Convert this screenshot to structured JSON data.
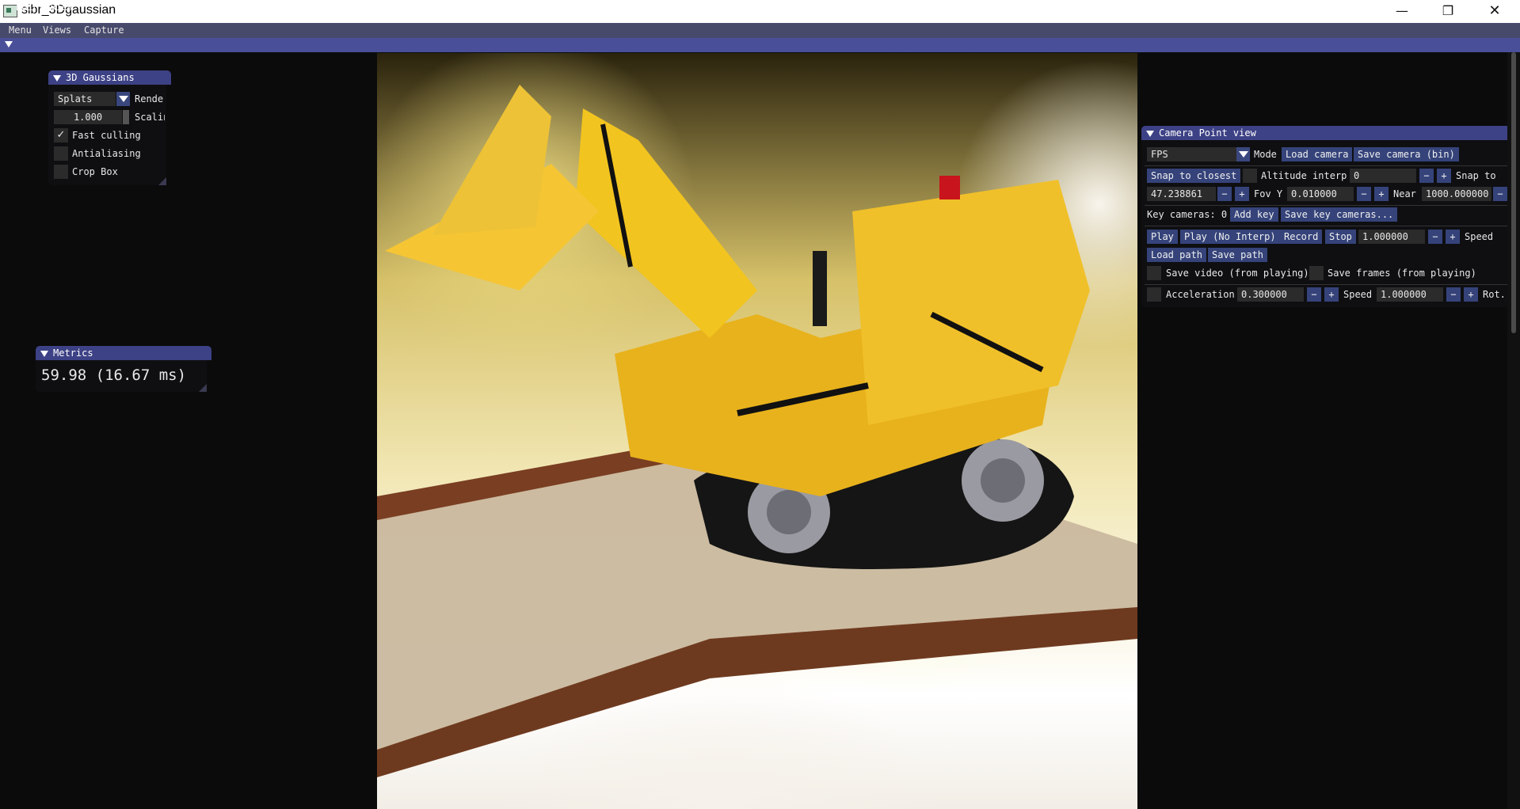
{
  "window": {
    "title": "sibr_3Dgaussian",
    "minimize": "—",
    "maximize": "❐",
    "close": "✕"
  },
  "menubar": {
    "items": [
      "Menu",
      "Views",
      "Capture"
    ]
  },
  "point_view": {
    "title": "Point view"
  },
  "gaussians": {
    "title": "3D Gaussians",
    "mode_value": "Splats",
    "render_label": "Render",
    "scaling_value": "1.000",
    "scaling_label": "Scaling",
    "fast_culling_label": "Fast culling",
    "fast_culling_checked": "✓",
    "antialiasing_label": "Antialiasing",
    "crop_box_label": "Crop Box"
  },
  "metrics": {
    "title": "Metrics",
    "value": "59.98 (16.67 ms)"
  },
  "camera": {
    "title": "Camera Point view",
    "mode_value": "FPS",
    "mode_label": "Mode",
    "load_camera": "Load camera",
    "save_camera": "Save camera (bin)",
    "snap_closest": "Snap to closest",
    "altitude_label": "Altitude interp",
    "altitude_value": "0",
    "snap_to_label": "Snap to",
    "val_1": "47.238861",
    "fov_label": "Fov Y",
    "fov_value": "0.010000",
    "near_label": "Near",
    "near_value": "1000.000000",
    "key_cameras_label": "Key cameras: 0",
    "add_key": "Add key",
    "save_key_cameras": "Save key cameras...",
    "play": "Play",
    "play_no_interp": "Play (No Interp)",
    "record": "Record",
    "stop": "Stop",
    "speed_value": "1.000000",
    "speed_label": "Speed",
    "load_path": "Load path",
    "save_path": "Save path",
    "save_video_label": "Save video (from playing)",
    "save_frames_label": "Save frames (from playing)",
    "acceleration_label": "Acceleration",
    "acceleration_value": "0.300000",
    "speed2_label": "Speed",
    "speed2_value": "1.000000",
    "rot_label": "Rot. sp",
    "minus": "−",
    "plus": "+"
  },
  "colors": {
    "menubar": "#484a6c",
    "header": "#4a4f99",
    "panel_title": "#3d4185",
    "button": "#35437a"
  }
}
